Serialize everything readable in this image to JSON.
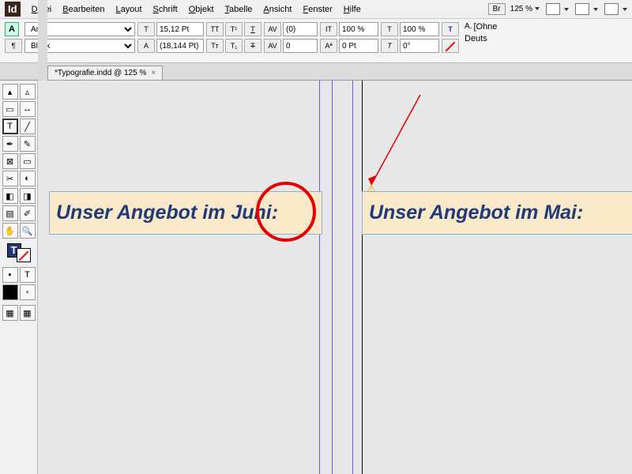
{
  "menu": {
    "items": [
      "Datei",
      "Bearbeiten",
      "Layout",
      "Schrift",
      "Objekt",
      "Tabelle",
      "Ansicht",
      "Fenster",
      "Hilfe"
    ],
    "bridge_label": "Br",
    "zoom": "125 %"
  },
  "control": {
    "font": "Arial",
    "style": "Black",
    "size": "15,12 Pt",
    "leading": "(18,144 Pt)",
    "tracking": "(0)",
    "kerning": "0",
    "hscale": "100 %",
    "vscale": "100 %",
    "baseline": "0 Pt",
    "parastyle": "[Ohne",
    "lang": "Deuts",
    "A": "A"
  },
  "tab": {
    "title": "*Typografie.indd @ 125 %"
  },
  "document": {
    "frame1": "Unser Angebot im Juni:",
    "frame2": "Unser Angebot im Mai:"
  }
}
